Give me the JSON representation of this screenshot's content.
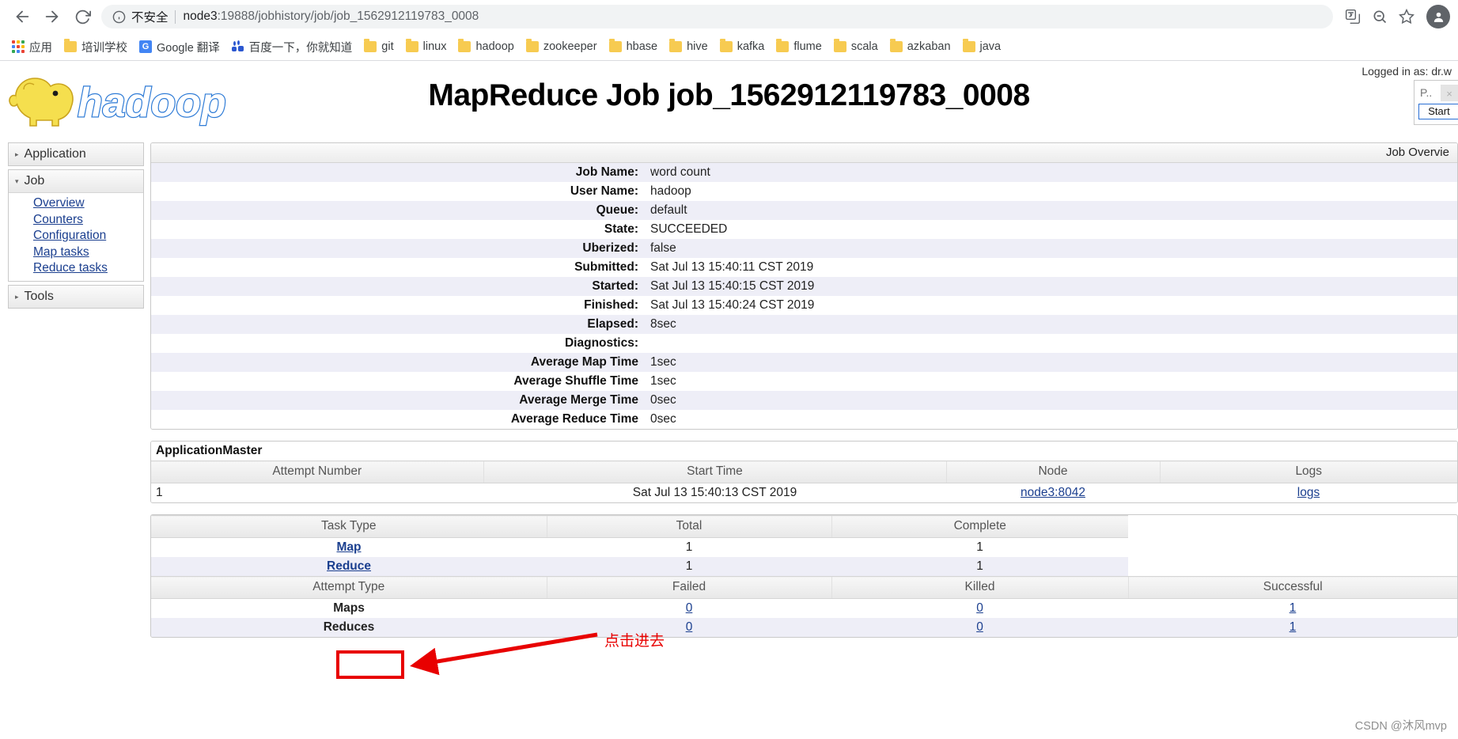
{
  "browser": {
    "back_icon": "back-arrow-icon",
    "forward_icon": "forward-arrow-icon",
    "reload_icon": "reload-icon",
    "info_icon": "info-circle-icon",
    "security_label": "不安全",
    "url_host": "node3",
    "url_rest": ":19888/jobhistory/job/job_1562912119783_0008",
    "translate_icon": "translate-icon",
    "zoom_out_icon": "zoom-out-icon",
    "bookmark_star_icon": "star-icon",
    "profile_icon": "profile-avatar-icon",
    "bookmarks": [
      {
        "label": "应用",
        "icon": "apps-grid-icon"
      },
      {
        "label": "培训学校",
        "icon": "folder-icon"
      },
      {
        "label": "Google 翻译",
        "icon": "google-translate-icon"
      },
      {
        "label": "百度一下，你就知道",
        "icon": "baidu-icon"
      },
      {
        "label": "git",
        "icon": "folder-icon"
      },
      {
        "label": "linux",
        "icon": "folder-icon"
      },
      {
        "label": "hadoop",
        "icon": "folder-icon"
      },
      {
        "label": "zookeeper",
        "icon": "folder-icon"
      },
      {
        "label": "hbase",
        "icon": "folder-icon"
      },
      {
        "label": "hive",
        "icon": "folder-icon"
      },
      {
        "label": "kafka",
        "icon": "folder-icon"
      },
      {
        "label": "flume",
        "icon": "folder-icon"
      },
      {
        "label": "scala",
        "icon": "folder-icon"
      },
      {
        "label": "azkaban",
        "icon": "folder-icon"
      },
      {
        "label": "java",
        "icon": "folder-icon"
      }
    ]
  },
  "header": {
    "logo_text": "hadoop",
    "title": "MapReduce Job job_1562912119783_0008",
    "logged_in_as": "Logged in as: dr.w",
    "search_placeholder": "P..",
    "clear_label": "×",
    "start_label": "Start"
  },
  "sidebar": {
    "groups": [
      {
        "label": "Application",
        "expanded": false,
        "arrow": "▸",
        "links": []
      },
      {
        "label": "Job",
        "expanded": true,
        "arrow": "▾",
        "links": [
          "Overview",
          "Counters",
          "Configuration",
          "Map tasks",
          "Reduce tasks"
        ]
      },
      {
        "label": "Tools",
        "expanded": false,
        "arrow": "▸",
        "links": []
      }
    ]
  },
  "overview": {
    "caption": "Job Overvie",
    "rows": [
      {
        "key": "Job Name:",
        "value": "word count"
      },
      {
        "key": "User Name:",
        "value": "hadoop"
      },
      {
        "key": "Queue:",
        "value": "default"
      },
      {
        "key": "State:",
        "value": "SUCCEEDED"
      },
      {
        "key": "Uberized:",
        "value": "false"
      },
      {
        "key": "Submitted:",
        "value": "Sat Jul 13 15:40:11 CST 2019"
      },
      {
        "key": "Started:",
        "value": "Sat Jul 13 15:40:15 CST 2019"
      },
      {
        "key": "Finished:",
        "value": "Sat Jul 13 15:40:24 CST 2019"
      },
      {
        "key": "Elapsed:",
        "value": "8sec"
      },
      {
        "key": "Diagnostics:",
        "value": ""
      },
      {
        "key": "Average Map Time",
        "value": "1sec"
      },
      {
        "key": "Average Shuffle Time",
        "value": "1sec"
      },
      {
        "key": "Average Merge Time",
        "value": "0sec"
      },
      {
        "key": "Average Reduce Time",
        "value": "0sec"
      }
    ]
  },
  "appmaster": {
    "title": "ApplicationMaster",
    "columns": [
      "Attempt Number",
      "Start Time",
      "Node",
      "Logs"
    ],
    "rows": [
      {
        "attempt": "1",
        "start_time": "Sat Jul 13 15:40:13 CST 2019",
        "node": "node3:8042",
        "logs": "logs"
      }
    ]
  },
  "tasks": {
    "columns": [
      "Task Type",
      "Total",
      "Complete"
    ],
    "rows": [
      {
        "type": "Map",
        "total": "1",
        "complete": "1"
      },
      {
        "type": "Reduce",
        "total": "1",
        "complete": "1"
      }
    ],
    "attempt_columns": [
      "Attempt Type",
      "Failed",
      "Killed",
      "Successful"
    ],
    "attempt_rows": [
      {
        "type": "Maps",
        "failed": "0",
        "killed": "0",
        "successful": "1"
      },
      {
        "type": "Reduces",
        "failed": "0",
        "killed": "0",
        "successful": "1"
      }
    ]
  },
  "annotation": {
    "text": "点击进去",
    "color": "#e80000",
    "target": "Map"
  },
  "watermark": "CSDN @沐风mvp"
}
